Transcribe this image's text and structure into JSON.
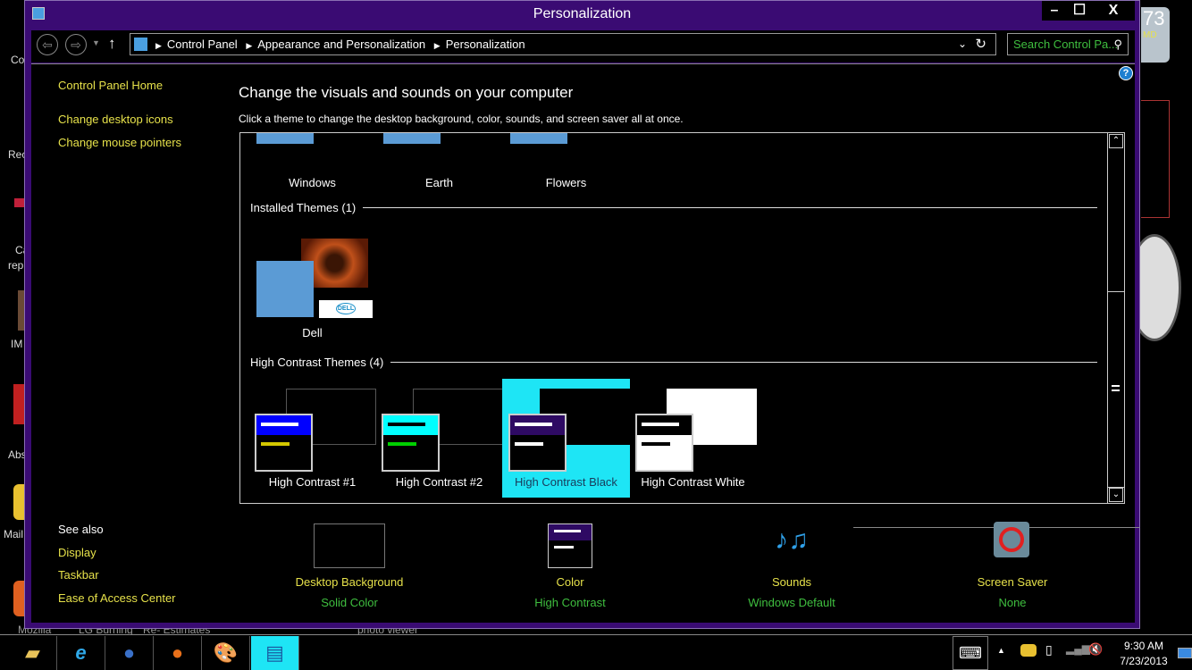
{
  "desktop": {
    "labels": [
      "Co",
      "Rec",
      "Ca",
      "rep",
      "IM",
      "Abs",
      "Mail",
      "Mozilla",
      "LG Burning",
      "Re- Estimates",
      "photo viewer",
      "73",
      "MD"
    ]
  },
  "window": {
    "title": "Personalization",
    "minimize": "–",
    "maximize": "☐",
    "close": "X"
  },
  "address": {
    "back": "⇦",
    "forward": "⇨",
    "up": "↑",
    "breadcrumb": [
      "Control Panel",
      "Appearance and Personalization",
      "Personalization"
    ],
    "search_placeholder": "Search Control Pa...",
    "help": "?"
  },
  "sidebar": {
    "home": "Control Panel Home",
    "links": [
      "Change desktop icons",
      "Change mouse pointers"
    ],
    "see_also": "See also",
    "see_also_links": [
      "Display",
      "Taskbar",
      "Ease of Access Center"
    ]
  },
  "main": {
    "heading": "Change the visuals and sounds on your computer",
    "subheading": "Click a theme to change the desktop background, color, sounds, and screen saver all at once.",
    "default_themes": [
      "Windows",
      "Earth",
      "Flowers"
    ],
    "installed_group": "Installed Themes (1)",
    "installed_themes": [
      "Dell"
    ],
    "dell_logo": "DELL",
    "hc_group": "High Contrast Themes (4)",
    "hc_themes": [
      {
        "name": "High Contrast #1",
        "bar": "#0000ff",
        "line1": "#ffffff",
        "line2": "#d4c800",
        "selected": false
      },
      {
        "name": "High Contrast #2",
        "bar": "#00ffff",
        "line1": "#000000",
        "line2": "#00d000",
        "selected": false
      },
      {
        "name": "High Contrast Black",
        "bar": "#2e0a63",
        "line1": "#ffffff",
        "line2": "#ffffff",
        "selected": true
      },
      {
        "name": "High Contrast White",
        "bar": "#000000",
        "line1": "#ffffff",
        "line2": "#000000",
        "selected": false
      }
    ]
  },
  "bottom": [
    {
      "label": "Desktop Background",
      "value": "Solid Color"
    },
    {
      "label": "Color",
      "value": "High Contrast"
    },
    {
      "label": "Sounds",
      "value": "Windows Default"
    },
    {
      "label": "Screen Saver",
      "value": "None"
    }
  ],
  "taskbar": {
    "apps": [
      "file-explorer",
      "internet-explorer",
      "thunderbird",
      "firefox",
      "paint",
      "control-panel"
    ],
    "time": "9:30 AM",
    "date": "7/23/2013"
  },
  "colors": {
    "window_border": "#3a0b73",
    "link": "#e6e14a",
    "value": "#3fbf3f",
    "selected": "#1ee5f5"
  }
}
